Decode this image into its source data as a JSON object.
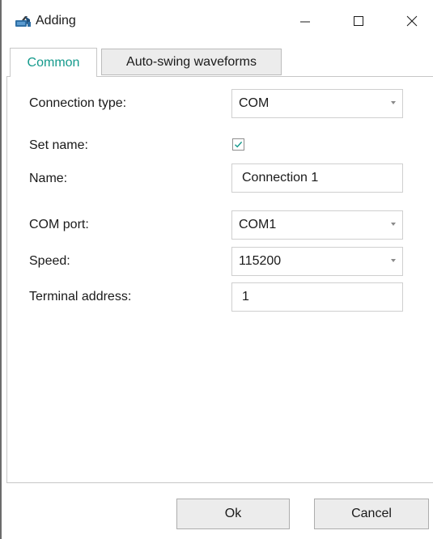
{
  "window": {
    "title": "Adding",
    "icon": "connection-app-icon"
  },
  "controls": {
    "minimize": "minimize-icon",
    "maximize": "maximize-icon",
    "close": "close-icon"
  },
  "tabs": [
    {
      "label": "Common",
      "active": true
    },
    {
      "label": "Auto-swing waveforms",
      "active": false
    }
  ],
  "form": {
    "connection_type": {
      "label": "Connection type:",
      "value": "COM"
    },
    "set_name": {
      "label": "Set name:",
      "checked": true
    },
    "name": {
      "label": "Name:",
      "value": "Connection 1"
    },
    "com_port": {
      "label": "COM port:",
      "value": "COM1"
    },
    "speed": {
      "label": "Speed:",
      "value": "115200"
    },
    "terminal_address": {
      "label": "Terminal address:",
      "value": "1"
    }
  },
  "buttons": {
    "ok": "Ok",
    "cancel": "Cancel"
  },
  "colors": {
    "active_tab_text": "#149a8c",
    "checkmark": "#149a8c",
    "inactive_tab_bg": "#ececec",
    "button_bg": "#ececec"
  }
}
